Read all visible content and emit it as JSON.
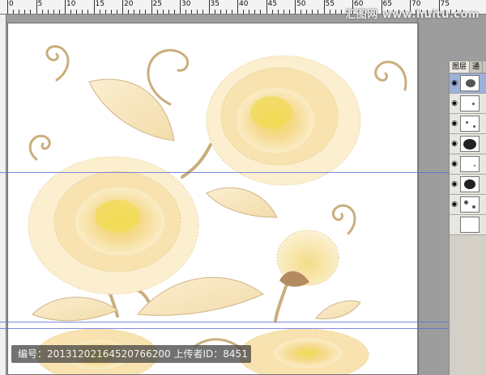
{
  "ruler": {
    "labels": [
      "0",
      "5",
      "10",
      "15",
      "20",
      "25",
      "30",
      "35",
      "40",
      "45",
      "50",
      "55",
      "60",
      "65",
      "70",
      "75"
    ]
  },
  "watermark": {
    "text": "汇图网 www.huitu.com"
  },
  "caption": {
    "text": "编号：20131202164520766200 上传者ID：8451"
  },
  "layers_panel": {
    "tabs": [
      "图层",
      "通"
    ]
  },
  "colors": {
    "petal_light": "#fbecc6",
    "petal_mid": "#f5d98c",
    "petal_center": "#f1dc53",
    "stem": "#c9ae7d",
    "guide": "#5f6cd6"
  }
}
